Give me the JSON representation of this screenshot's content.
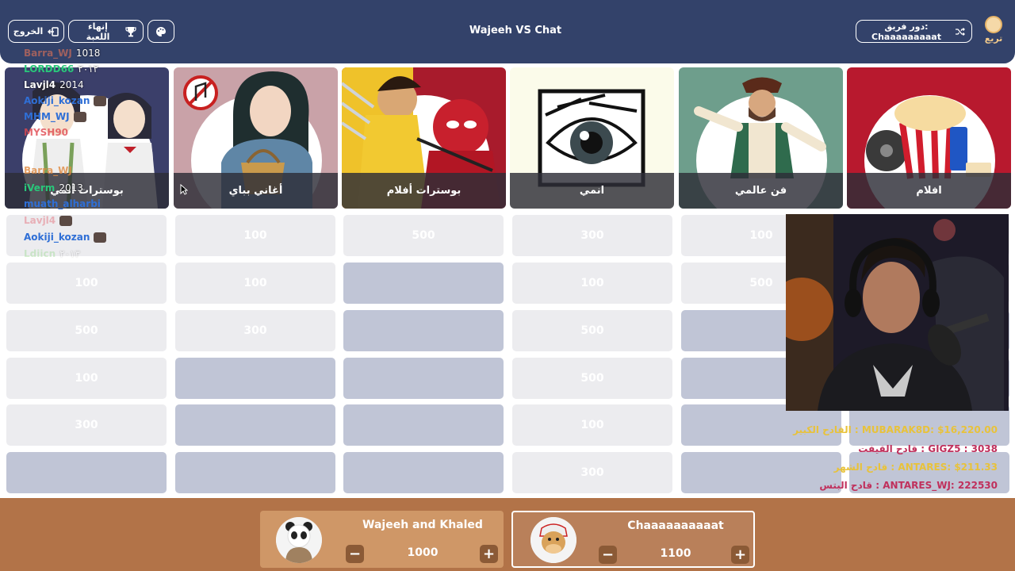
{
  "header": {
    "title": "Wajeeh VS Chat",
    "exit_label": "الخروج",
    "end_game_label": "إنهاء اللعبة",
    "turn_label": "دور فريق: Chaaaaaaaaat",
    "logo_text": "تريع"
  },
  "categories": [
    {
      "label": "افلام",
      "icon": "popcorn-cinema-icon",
      "color": "#b8192e"
    },
    {
      "label": "فن عالمي",
      "icon": "pirate-icon",
      "color": "#6e9e8c"
    },
    {
      "label": "انمي",
      "icon": "anime-eye-icon",
      "color": "#fbfbea"
    },
    {
      "label": "بوسترات أفلام",
      "icon": "deadpool-wolverine-icon",
      "color": "#a81b2c"
    },
    {
      "label": "أغاني بباي",
      "icon": "no-music-icon",
      "color": "#c9a2a8"
    },
    {
      "label": "بوسترات أنمي",
      "icon": "anime-couple-icon",
      "color": "#3b3f6a"
    }
  ],
  "grid": {
    "columns": [
      {
        "cells": [
          {
            "value": "100",
            "used": false
          },
          {
            "value": "500",
            "used": false
          },
          {
            "value": "",
            "used": true
          },
          {
            "value": "",
            "used": true
          },
          {
            "value": "",
            "used": true
          },
          {
            "value": "",
            "used": true
          }
        ]
      },
      {
        "cells": [
          {
            "value": "100",
            "used": false
          },
          {
            "value": "500",
            "used": false
          },
          {
            "value": "",
            "used": true
          },
          {
            "value": "",
            "used": true
          },
          {
            "value": "",
            "used": true
          },
          {
            "value": "",
            "used": true
          }
        ]
      },
      {
        "cells": [
          {
            "value": "300",
            "used": false
          },
          {
            "value": "100",
            "used": false
          },
          {
            "value": "500",
            "used": false
          },
          {
            "value": "500",
            "used": false
          },
          {
            "value": "100",
            "used": false
          },
          {
            "value": "300",
            "used": false
          }
        ]
      },
      {
        "cells": [
          {
            "value": "500",
            "used": false
          },
          {
            "value": "",
            "used": true
          },
          {
            "value": "",
            "used": true
          },
          {
            "value": "",
            "used": true
          },
          {
            "value": "",
            "used": true
          },
          {
            "value": "",
            "used": true
          }
        ]
      },
      {
        "cells": [
          {
            "value": "100",
            "used": false
          },
          {
            "value": "100",
            "used": false
          },
          {
            "value": "300",
            "used": false
          },
          {
            "value": "",
            "used": true
          },
          {
            "value": "",
            "used": true
          },
          {
            "value": "",
            "used": true
          }
        ]
      },
      {
        "cells": [
          {
            "value": "",
            "used": false
          },
          {
            "value": "100",
            "used": false
          },
          {
            "value": "500",
            "used": false
          },
          {
            "value": "100",
            "used": false
          },
          {
            "value": "300",
            "used": false
          },
          {
            "value": "",
            "used": false
          }
        ]
      }
    ]
  },
  "chat": [
    {
      "user": "Barra_WJ",
      "text": "1018",
      "color": "#c46a5a"
    },
    {
      "user": "LORDD66",
      "text": "٢٠١٢",
      "color": "#29c77a"
    },
    {
      "user": "Lavjl4",
      "text": "2014",
      "color": "#ffffff"
    },
    {
      "user": "Aokiji_kozan",
      "text": "",
      "color": "#2f6fd6"
    },
    {
      "user": "MHM_WJ",
      "text": "",
      "color": "#2f6fd6"
    },
    {
      "user": "MYSH90",
      "text": "",
      "color": "#e0484f"
    },
    {
      "user": "Barra_WJ",
      "text": "",
      "color": "#e08a40"
    },
    {
      "user": "iVerm",
      "text": "2013",
      "color": "#29c77a"
    },
    {
      "user": "muath_alharbi",
      "text": "",
      "color": "#2f6fd6"
    },
    {
      "user": "Lavjl4",
      "text": "",
      "color": "#e8a0a8"
    },
    {
      "user": "Aokiji_kozan",
      "text": "",
      "color": "#2f6fd6"
    },
    {
      "user": "Ldiicn",
      "text": "٢٠١٣",
      "color": "#8bd57e"
    }
  ],
  "stats": [
    {
      "text": "القادح الكبير : MUBARAK8D: $16,220.00",
      "color": "#e8c23a"
    },
    {
      "text": "قادح القيفت : GIGZ5 : 3038",
      "color": "#c0305c"
    },
    {
      "text": "قادح الشهر : ANTARES: $211.33",
      "color": "#e8c23a"
    },
    {
      "text": "قادح البتس : ANTARES_WJ: 222530",
      "color": "#c0305c"
    }
  ],
  "teams": [
    {
      "name": "Wajeeh and Khaled",
      "score": "1000",
      "avatar": "panda-avatar-icon"
    },
    {
      "name": "Chaaaaaaaaaat",
      "score": "1100",
      "avatar": "camel-avatar-icon"
    }
  ]
}
